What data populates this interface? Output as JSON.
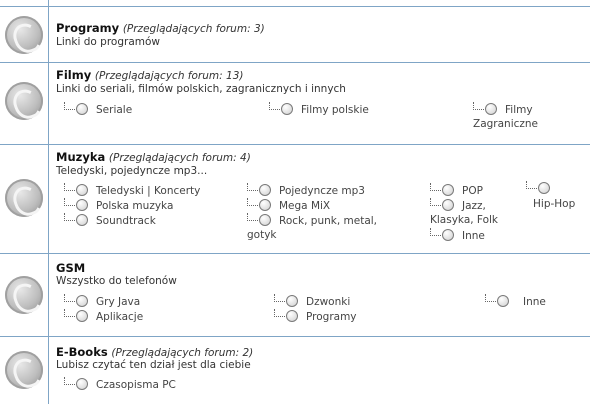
{
  "forums": [
    {
      "title": "Programy",
      "viewers": "(Przeglądających forum: 3)",
      "description": "Linki do programów",
      "subforums": []
    },
    {
      "title": "Filmy",
      "viewers": "(Przeglądających forum: 13)",
      "description": "Linki do seriali, filmów polskich, zagranicznych i innych",
      "subforums": [
        "Seriale",
        "Filmy polskie",
        "Filmy",
        "Zagraniczne"
      ]
    },
    {
      "title": "Muzyka",
      "viewers": "(Przeglądających forum: 4)",
      "description": "Teledyski, pojedyncze mp3...",
      "subforums": [
        "Teledyski | Koncerty",
        "Polska muzyka",
        "Soundtrack",
        "Pojedyncze mp3",
        "Mega MiX",
        "Rock, punk, metal,",
        "gotyk",
        "POP",
        "Jazz,",
        "Klasyka, Folk",
        "Inne",
        "Hip-Hop"
      ]
    },
    {
      "title": "GSM",
      "viewers": "",
      "description": "Wszystko do telefonów",
      "subforums": [
        "Gry Java",
        "Aplikacje",
        "Dzwonki",
        "Programy",
        "Inne"
      ]
    },
    {
      "title": "E-Books",
      "viewers": "(Przeglądających forum: 2)",
      "description": "Lubisz czytać ten dział jest dla ciebie",
      "subforums": [
        "Czasopisma PC"
      ]
    }
  ]
}
